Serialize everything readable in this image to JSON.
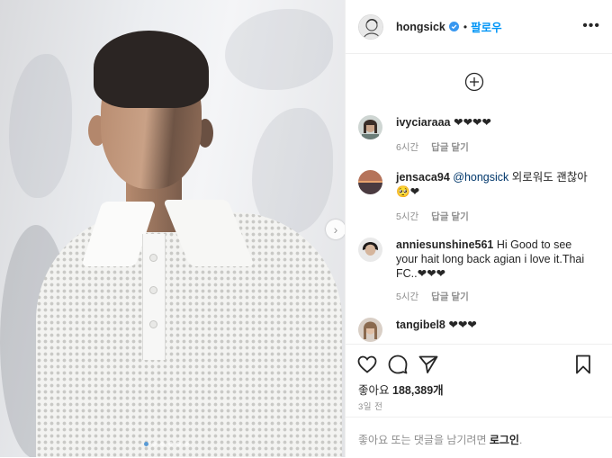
{
  "header": {
    "username": "hongsick",
    "separator": "•",
    "follow_label": "팔로우",
    "more_label": "•••"
  },
  "comments": [
    {
      "user": "ivyciaraaa",
      "text": "❤❤❤❤",
      "mention": "",
      "time": "6시간",
      "reply": "답글 달기"
    },
    {
      "user": "jensaca94",
      "mention": "@hongsick",
      "text": "외로워도 괜찮아 🥺❤",
      "time": "5시간",
      "reply": "답글 달기"
    },
    {
      "user": "anniesunshine561",
      "mention": "",
      "text": "Hi Good to see your hait long back agian i love it.Thai FC..❤❤❤",
      "time": "5시간",
      "reply": "답글 달기"
    },
    {
      "user": "tangibel8",
      "mention": "",
      "text": "❤❤❤",
      "time": "",
      "reply": ""
    }
  ],
  "actions": {
    "likes_prefix": "좋아요",
    "likes_count": "188,389개",
    "date": "3일 전"
  },
  "login_bar": {
    "prompt": "좋아요 또는 댓글을 남기려면",
    "login_link": "로그인",
    "suffix": "."
  },
  "carousel": {
    "total_slides": 6,
    "active_slide": 1
  },
  "colors": {
    "accent": "#0095f6",
    "verified": "#3897f0",
    "meta_text": "#8e8e8e",
    "divider": "#efefef"
  },
  "icons": [
    "next-arrow-icon",
    "verified-badge-icon",
    "more-icon",
    "add-comment-icon",
    "heart-icon",
    "comment-icon",
    "share-icon",
    "bookmark-icon"
  ]
}
